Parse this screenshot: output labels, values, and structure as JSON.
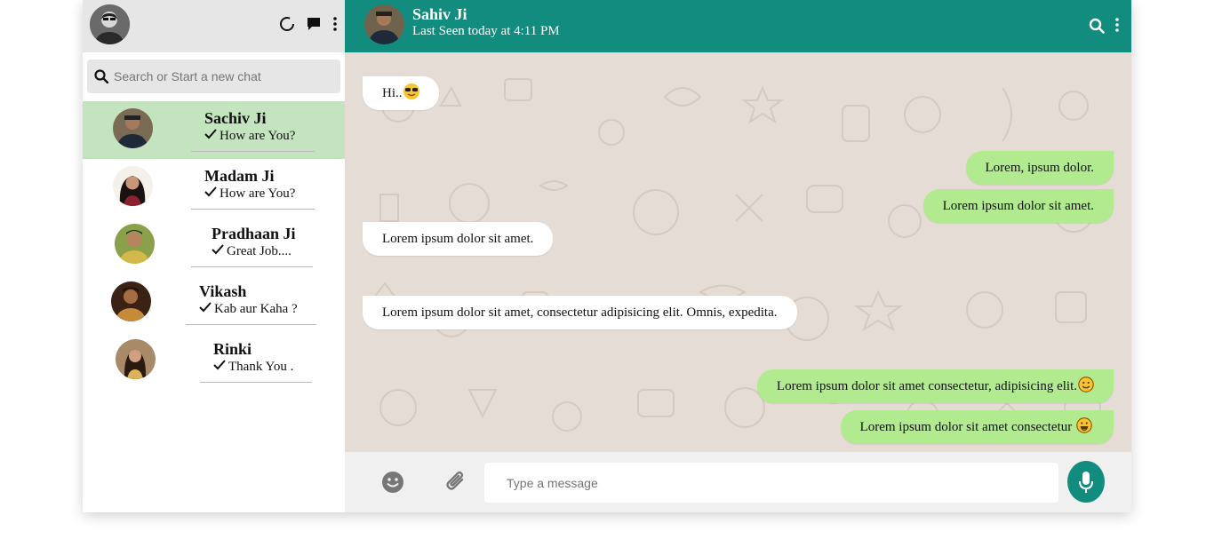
{
  "sidebar": {
    "search_placeholder": "Search or Start a new chat",
    "chats": [
      {
        "name": "Sachiv Ji",
        "last_message": "How are You?",
        "active": true
      },
      {
        "name": "Madam Ji",
        "last_message": "How are You?",
        "active": false
      },
      {
        "name": "Pradhaan Ji",
        "last_message": "Great Job....",
        "active": false
      },
      {
        "name": "Vikash",
        "last_message": "Kab aur Kaha ?",
        "active": false
      },
      {
        "name": "Rinki",
        "last_message": "Thank You .",
        "active": false
      }
    ],
    "header_icons": [
      "status-icon",
      "new-chat-icon",
      "menu-icon"
    ]
  },
  "chat": {
    "contact_name": "Sahiv Ji",
    "status": "Last Seen today at 4:11 PM",
    "header_icons": [
      "search-icon",
      "menu-icon"
    ],
    "messages": [
      {
        "side": "in",
        "text": "Hi..",
        "emoji": "sunglasses-emoji"
      },
      {
        "side": "out",
        "text": "Lorem, ipsum dolor."
      },
      {
        "side": "out",
        "text": "Lorem ipsum dolor sit amet."
      },
      {
        "side": "in",
        "text": "Lorem ipsum dolor sit amet."
      },
      {
        "side": "in",
        "text": "Lorem ipsum dolor sit amet, consectetur adipisicing elit. Omnis, expedita."
      },
      {
        "side": "out",
        "text": "Lorem ipsum dolor sit amet consectetur, adipisicing elit.",
        "emoji": "smile-emoji"
      },
      {
        "side": "out",
        "text": "Lorem ipsum dolor sit amet consectetur ",
        "emoji": "grin-emoji"
      }
    ],
    "composer_placeholder": "Type a message"
  },
  "colors": {
    "header_green": "#128c7e",
    "active_chat": "#c4e4c0",
    "outgoing_bubble": "#b1ea8f",
    "chat_background": "#e5ddd5"
  }
}
